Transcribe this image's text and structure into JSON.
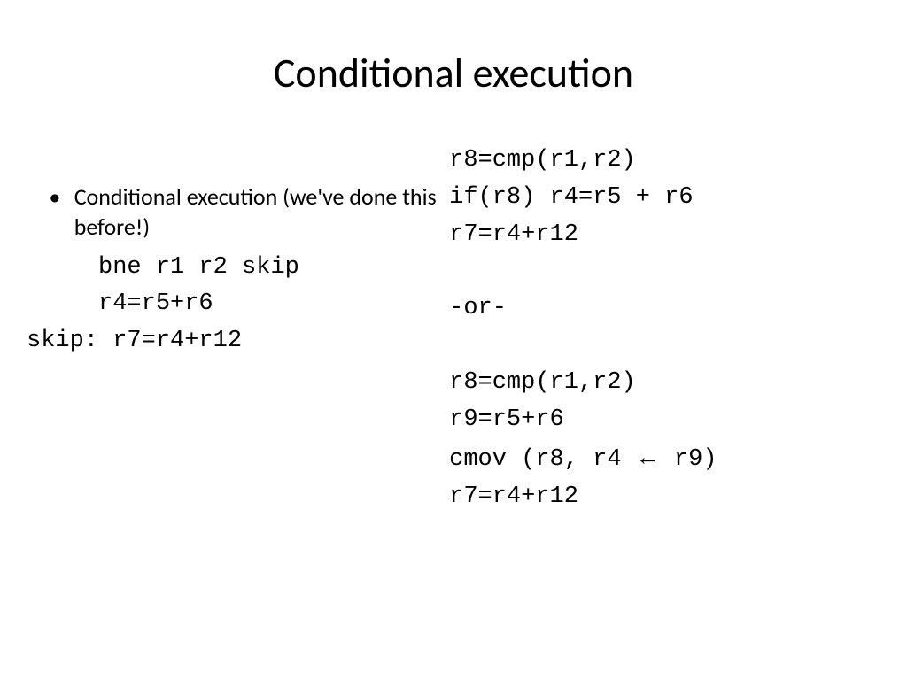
{
  "title": "Conditional execution",
  "left": {
    "bullet_text": "Conditional execution (we've done this before!)",
    "code_line1": "     bne r1 r2 skip",
    "code_line2": "     r4=r5+r6",
    "code_line3": "skip: r7=r4+r12"
  },
  "right": {
    "line1": "r8=cmp(r1,r2)",
    "line2": "if(r8) r4=r5 + r6",
    "line3": "r7=r4+r12",
    "or_label": "-or-",
    "line4": "r8=cmp(r1,r2)",
    "line5": "r9=r5+r6",
    "line6_pre": "cmov (r8, r4 ",
    "arrow": "←",
    "line6_post": " r9)",
    "line7": "r7=r4+r12"
  }
}
